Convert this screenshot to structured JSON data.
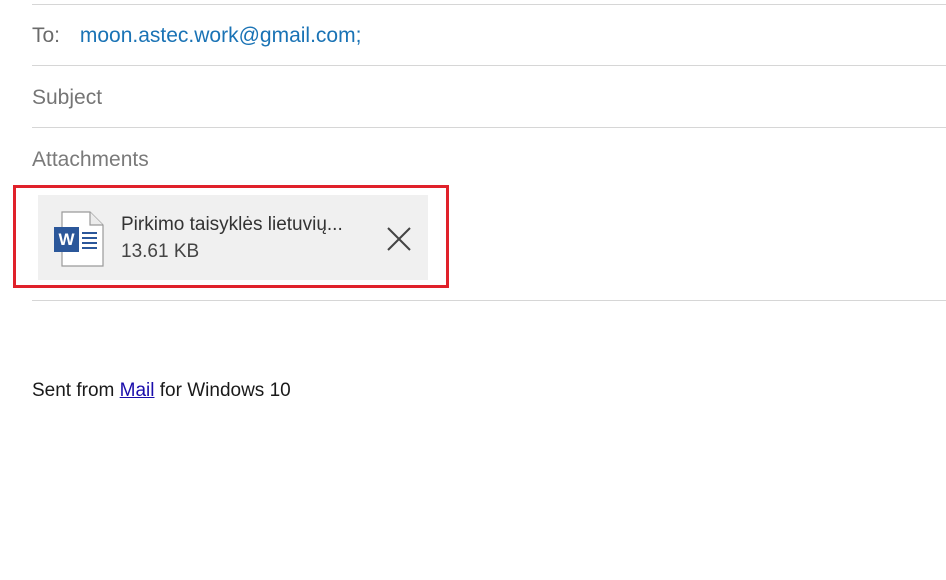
{
  "recipients": {
    "label": "To:",
    "value": "moon.astec.work@gmail.com;"
  },
  "subject": {
    "placeholder": "Subject",
    "value": ""
  },
  "attachments": {
    "label": "Attachments",
    "items": [
      {
        "name": "Pirkimo taisyklės lietuvių...",
        "size": "13.61 KB",
        "icon": "word-document-icon"
      }
    ]
  },
  "signature": {
    "prefix": "Sent from ",
    "link": "Mail",
    "suffix": " for Windows 10"
  },
  "colors": {
    "highlight": "#e0212a",
    "recipient": "#1a73b5",
    "word_blue": "#2b579a"
  }
}
